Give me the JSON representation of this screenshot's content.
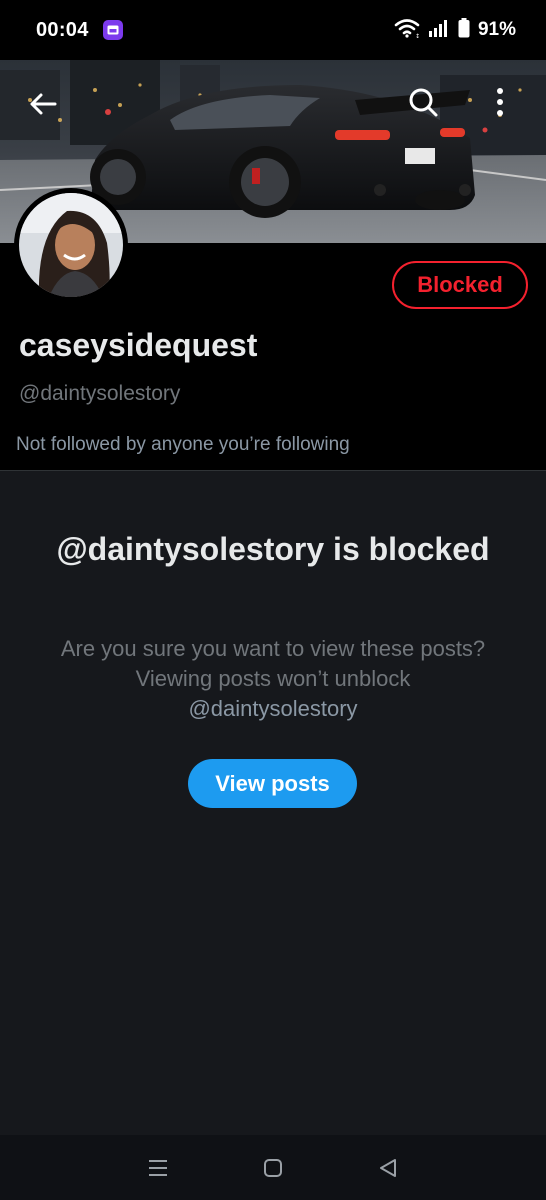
{
  "status_bar": {
    "time": "00:04",
    "battery": "91%"
  },
  "profile": {
    "display_name": "caseysidequest",
    "handle": "@daintysolestory",
    "followed_by": "Not followed by anyone you’re following",
    "blocked_label": "Blocked"
  },
  "blocked_panel": {
    "title": "@daintysolestory is blocked",
    "desc_text": "Are you sure you want to view these posts? Viewing posts won’t unblock",
    "desc_handle": "@daintysolestory",
    "view_posts_label": "View posts"
  },
  "icons": {
    "back": "arrow-left-icon",
    "search": "search-icon",
    "more": "more-vertical-icon",
    "notification": "mail-app-icon",
    "wifi": "wifi-icon",
    "signal": "signal-icon",
    "battery": "battery-icon",
    "nav_recents": "recents-icon",
    "nav_home": "home-icon",
    "nav_back": "back-triangle-icon"
  },
  "colors": {
    "blocked_red": "#f4212e",
    "primary_blue": "#1d9bf0",
    "notification_purple": "#7c3aed"
  }
}
